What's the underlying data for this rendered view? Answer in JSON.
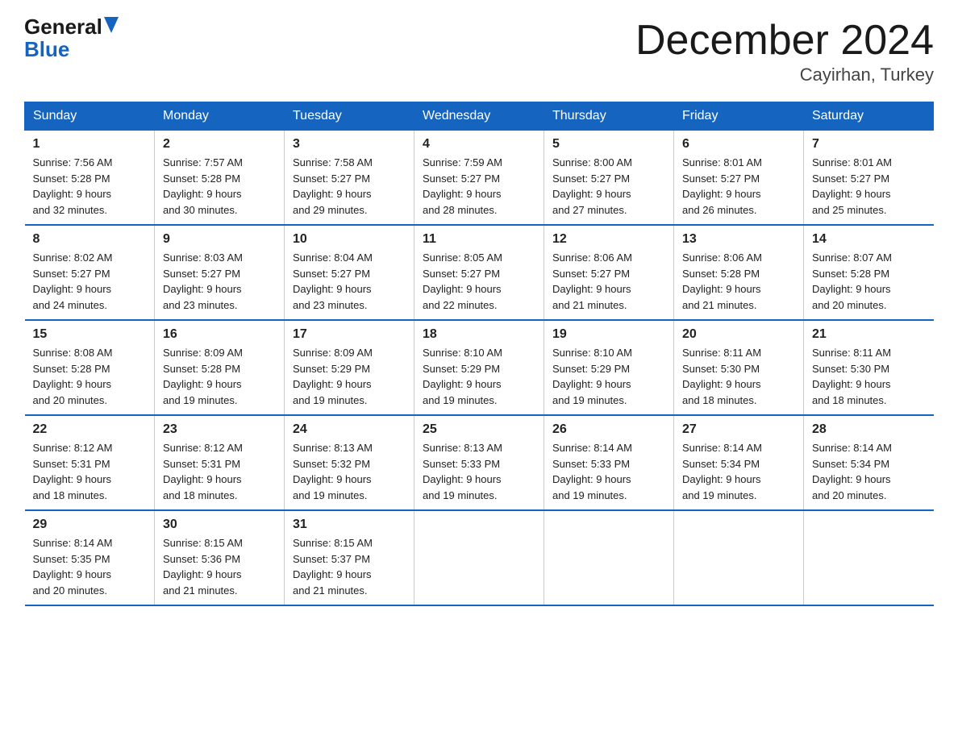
{
  "header": {
    "logo_line1": "General",
    "logo_line2": "Blue",
    "month_title": "December 2024",
    "location": "Cayirhan, Turkey"
  },
  "days_of_week": [
    "Sunday",
    "Monday",
    "Tuesday",
    "Wednesday",
    "Thursday",
    "Friday",
    "Saturday"
  ],
  "weeks": [
    [
      {
        "day": "1",
        "info": "Sunrise: 7:56 AM\nSunset: 5:28 PM\nDaylight: 9 hours\nand 32 minutes."
      },
      {
        "day": "2",
        "info": "Sunrise: 7:57 AM\nSunset: 5:28 PM\nDaylight: 9 hours\nand 30 minutes."
      },
      {
        "day": "3",
        "info": "Sunrise: 7:58 AM\nSunset: 5:27 PM\nDaylight: 9 hours\nand 29 minutes."
      },
      {
        "day": "4",
        "info": "Sunrise: 7:59 AM\nSunset: 5:27 PM\nDaylight: 9 hours\nand 28 minutes."
      },
      {
        "day": "5",
        "info": "Sunrise: 8:00 AM\nSunset: 5:27 PM\nDaylight: 9 hours\nand 27 minutes."
      },
      {
        "day": "6",
        "info": "Sunrise: 8:01 AM\nSunset: 5:27 PM\nDaylight: 9 hours\nand 26 minutes."
      },
      {
        "day": "7",
        "info": "Sunrise: 8:01 AM\nSunset: 5:27 PM\nDaylight: 9 hours\nand 25 minutes."
      }
    ],
    [
      {
        "day": "8",
        "info": "Sunrise: 8:02 AM\nSunset: 5:27 PM\nDaylight: 9 hours\nand 24 minutes."
      },
      {
        "day": "9",
        "info": "Sunrise: 8:03 AM\nSunset: 5:27 PM\nDaylight: 9 hours\nand 23 minutes."
      },
      {
        "day": "10",
        "info": "Sunrise: 8:04 AM\nSunset: 5:27 PM\nDaylight: 9 hours\nand 23 minutes."
      },
      {
        "day": "11",
        "info": "Sunrise: 8:05 AM\nSunset: 5:27 PM\nDaylight: 9 hours\nand 22 minutes."
      },
      {
        "day": "12",
        "info": "Sunrise: 8:06 AM\nSunset: 5:27 PM\nDaylight: 9 hours\nand 21 minutes."
      },
      {
        "day": "13",
        "info": "Sunrise: 8:06 AM\nSunset: 5:28 PM\nDaylight: 9 hours\nand 21 minutes."
      },
      {
        "day": "14",
        "info": "Sunrise: 8:07 AM\nSunset: 5:28 PM\nDaylight: 9 hours\nand 20 minutes."
      }
    ],
    [
      {
        "day": "15",
        "info": "Sunrise: 8:08 AM\nSunset: 5:28 PM\nDaylight: 9 hours\nand 20 minutes."
      },
      {
        "day": "16",
        "info": "Sunrise: 8:09 AM\nSunset: 5:28 PM\nDaylight: 9 hours\nand 19 minutes."
      },
      {
        "day": "17",
        "info": "Sunrise: 8:09 AM\nSunset: 5:29 PM\nDaylight: 9 hours\nand 19 minutes."
      },
      {
        "day": "18",
        "info": "Sunrise: 8:10 AM\nSunset: 5:29 PM\nDaylight: 9 hours\nand 19 minutes."
      },
      {
        "day": "19",
        "info": "Sunrise: 8:10 AM\nSunset: 5:29 PM\nDaylight: 9 hours\nand 19 minutes."
      },
      {
        "day": "20",
        "info": "Sunrise: 8:11 AM\nSunset: 5:30 PM\nDaylight: 9 hours\nand 18 minutes."
      },
      {
        "day": "21",
        "info": "Sunrise: 8:11 AM\nSunset: 5:30 PM\nDaylight: 9 hours\nand 18 minutes."
      }
    ],
    [
      {
        "day": "22",
        "info": "Sunrise: 8:12 AM\nSunset: 5:31 PM\nDaylight: 9 hours\nand 18 minutes."
      },
      {
        "day": "23",
        "info": "Sunrise: 8:12 AM\nSunset: 5:31 PM\nDaylight: 9 hours\nand 18 minutes."
      },
      {
        "day": "24",
        "info": "Sunrise: 8:13 AM\nSunset: 5:32 PM\nDaylight: 9 hours\nand 19 minutes."
      },
      {
        "day": "25",
        "info": "Sunrise: 8:13 AM\nSunset: 5:33 PM\nDaylight: 9 hours\nand 19 minutes."
      },
      {
        "day": "26",
        "info": "Sunrise: 8:14 AM\nSunset: 5:33 PM\nDaylight: 9 hours\nand 19 minutes."
      },
      {
        "day": "27",
        "info": "Sunrise: 8:14 AM\nSunset: 5:34 PM\nDaylight: 9 hours\nand 19 minutes."
      },
      {
        "day": "28",
        "info": "Sunrise: 8:14 AM\nSunset: 5:34 PM\nDaylight: 9 hours\nand 20 minutes."
      }
    ],
    [
      {
        "day": "29",
        "info": "Sunrise: 8:14 AM\nSunset: 5:35 PM\nDaylight: 9 hours\nand 20 minutes."
      },
      {
        "day": "30",
        "info": "Sunrise: 8:15 AM\nSunset: 5:36 PM\nDaylight: 9 hours\nand 21 minutes."
      },
      {
        "day": "31",
        "info": "Sunrise: 8:15 AM\nSunset: 5:37 PM\nDaylight: 9 hours\nand 21 minutes."
      },
      {
        "day": "",
        "info": ""
      },
      {
        "day": "",
        "info": ""
      },
      {
        "day": "",
        "info": ""
      },
      {
        "day": "",
        "info": ""
      }
    ]
  ]
}
